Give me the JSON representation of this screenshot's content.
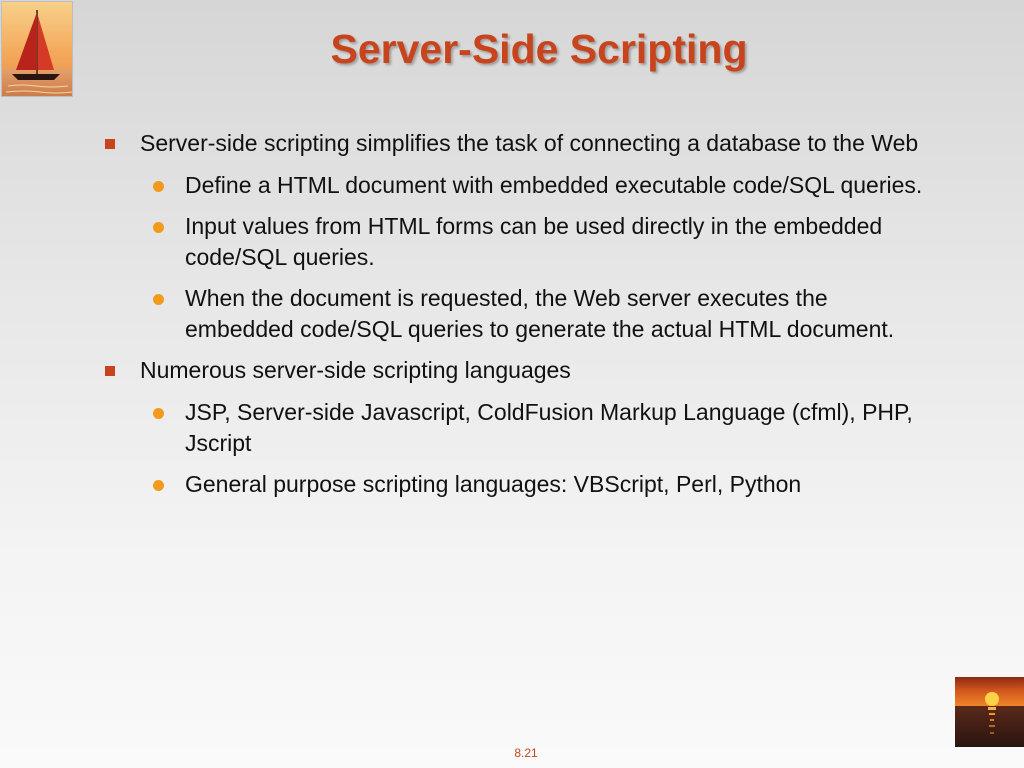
{
  "slide": {
    "title": "Server-Side Scripting",
    "page_number": "8.21",
    "bullets": [
      {
        "text": "Server-side scripting simplifies the task of connecting a database to the Web",
        "sub": [
          "Define a HTML document with embedded executable code/SQL queries.",
          "Input values from HTML forms can be used directly in the embedded code/SQL queries.",
          "When the document is requested, the Web server executes the embedded code/SQL queries to generate the actual HTML document."
        ]
      },
      {
        "text": "Numerous server-side scripting languages",
        "sub": [
          "JSP, Server-side Javascript, ColdFusion Markup Language (cfml), PHP, Jscript",
          "General purpose scripting languages: VBScript, Perl, Python"
        ]
      }
    ]
  },
  "colors": {
    "accent": "#c8441c",
    "sub_bullet": "#f29a1c"
  },
  "images": {
    "top_left": "sailboat-image",
    "bottom_right": "sunset-image"
  }
}
